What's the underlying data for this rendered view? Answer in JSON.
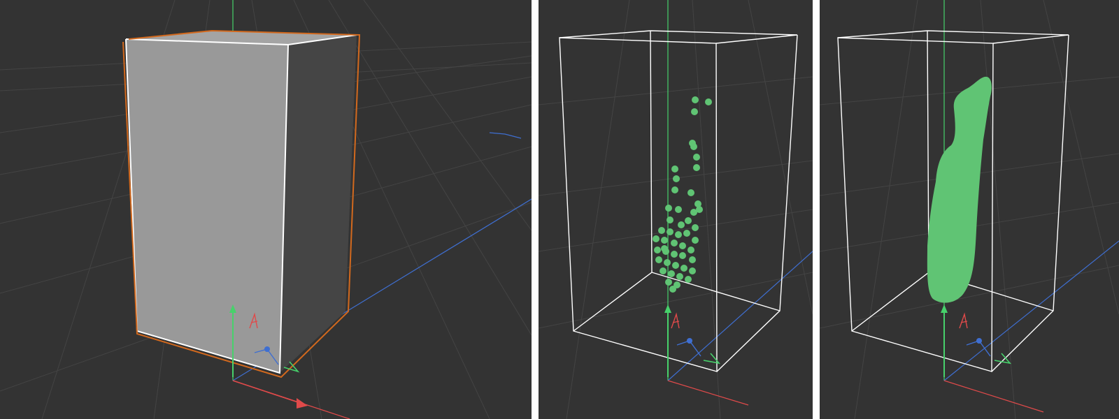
{
  "viewports": [
    {
      "id": "geometry",
      "object": "box",
      "display": "solid",
      "selected": true,
      "selection_color": "#d2691e"
    },
    {
      "id": "particles",
      "object": "particles",
      "display": "points",
      "points_color": "#60c474"
    },
    {
      "id": "fluid_surface",
      "object": "fluid-mesh",
      "display": "solid",
      "surface_color": "#60c474"
    }
  ],
  "colors": {
    "background": "#333333",
    "grid": "#444444",
    "box_front": "#999999",
    "box_side": "#454545",
    "wireframe": "#ffffff",
    "axis_x": "#e04a4a",
    "axis_y": "#47d16b",
    "axis_z": "#3f6fd1",
    "selection": "#d2691e",
    "fluid": "#60c474"
  },
  "icons": [
    "light-gizmo-icon",
    "camera-gizmo-icon",
    "y-axis-arrow-icon",
    "x-axis-arrow-icon"
  ]
}
